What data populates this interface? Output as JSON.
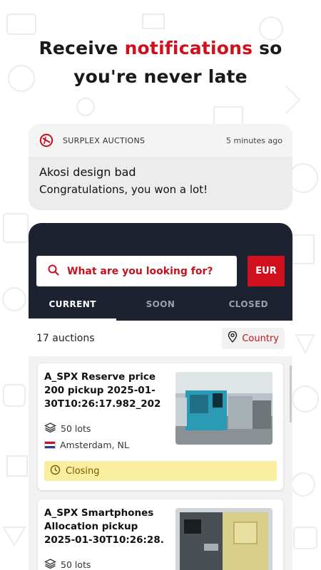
{
  "headline": {
    "pre": "Receive ",
    "accent": "notifications",
    "post": " so",
    "line2": "you're never late"
  },
  "notification": {
    "app_name": "SURPLEX AUCTIONS",
    "time": "5 minutes ago",
    "title": "Akosi design bad",
    "text": "Congratulations, you won a lot!"
  },
  "app": {
    "search_placeholder": "What are you looking for?",
    "currency": "EUR",
    "tabs": [
      {
        "label": "CURRENT",
        "active": true
      },
      {
        "label": "SOON",
        "active": false
      },
      {
        "label": "CLOSED",
        "active": false
      }
    ],
    "auction_count": "17 auctions",
    "country_filter": "Country",
    "auctions": [
      {
        "title": "A_SPX Reserve price 200 pickup 2025-01-30T10:26:17.982_202",
        "lots": "50 lots",
        "location": "Amsterdam, NL",
        "status": "Closing"
      },
      {
        "title": "A_SPX Smartphones Allocation pickup 2025-01-30T10:26:28.",
        "lots": "50 lots"
      }
    ]
  },
  "colors": {
    "brand_red": "#d0101c",
    "header_navy": "#1c2230",
    "closing_yellow": "#f9ee9f"
  }
}
